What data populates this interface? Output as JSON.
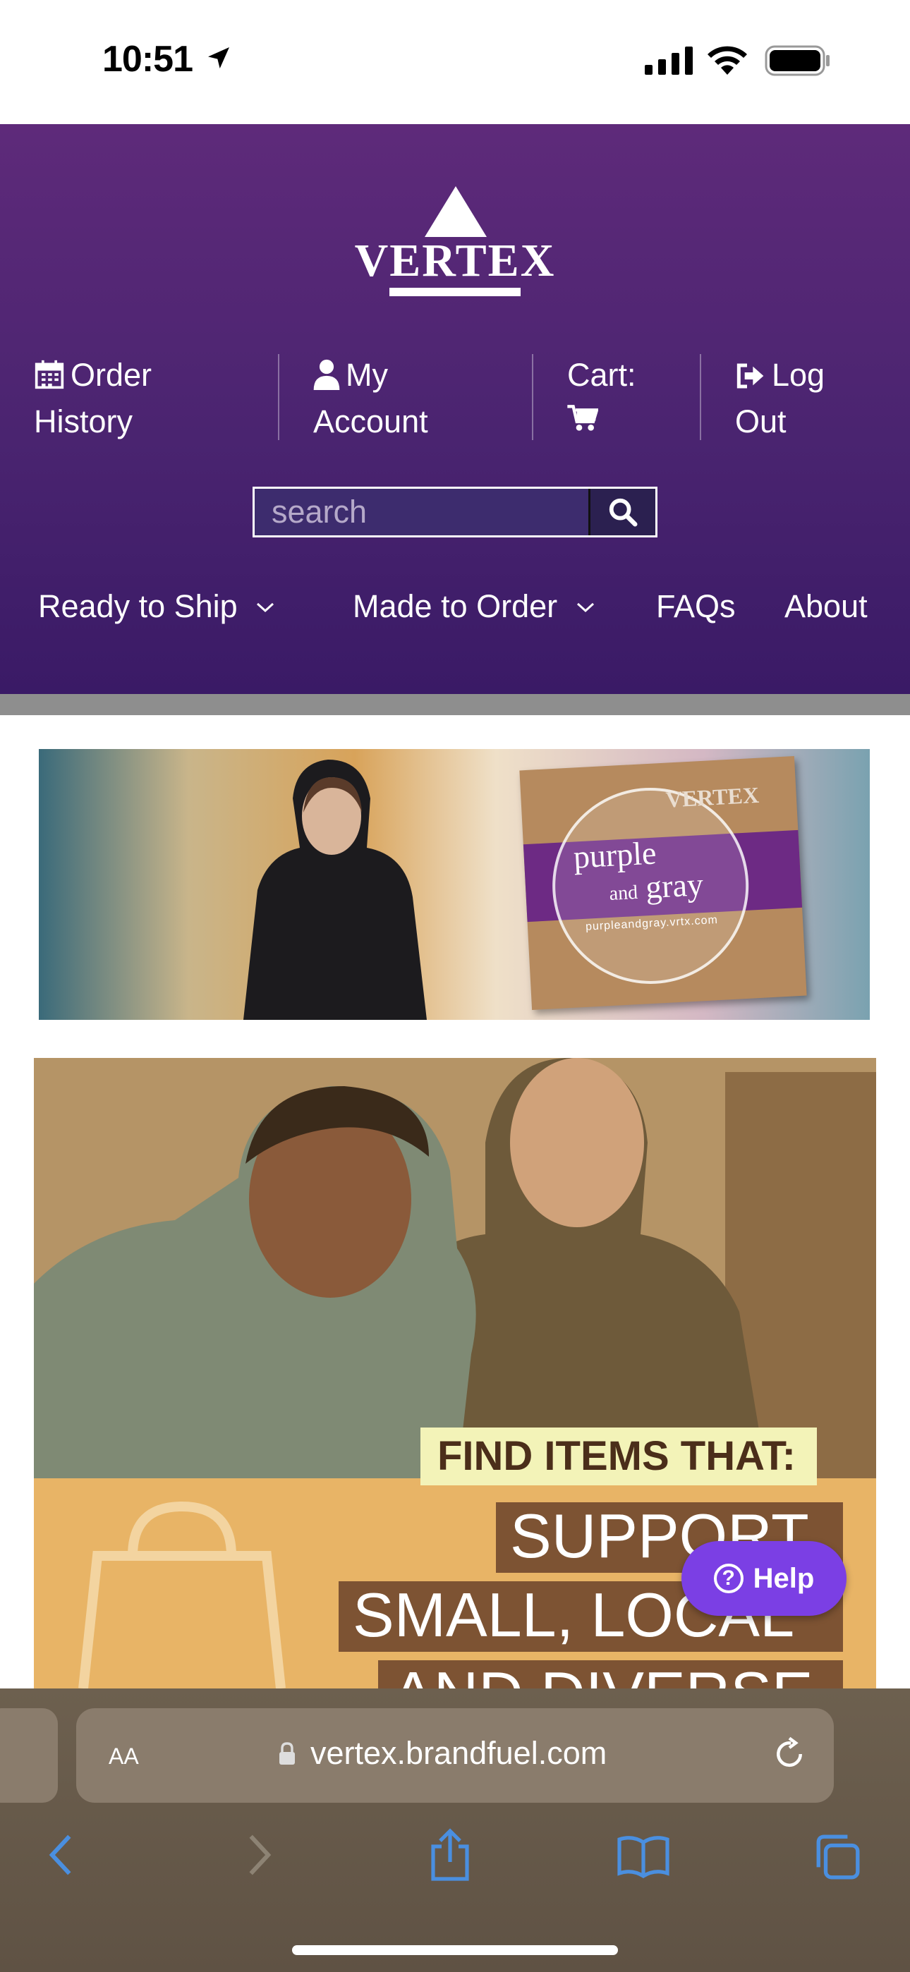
{
  "status_bar": {
    "time": "10:51"
  },
  "header": {
    "logo_text": "VERTEX",
    "account_links": [
      {
        "line1": "Order",
        "line2": "History",
        "icon": "calendar-icon"
      },
      {
        "line1": "My",
        "line2": "Account",
        "icon": "user-icon"
      },
      {
        "line1": "Cart:",
        "line2": "",
        "icon": "cart-icon"
      },
      {
        "line1": "Log",
        "line2": "Out",
        "icon": "sign-out-icon"
      }
    ],
    "search": {
      "placeholder": "search"
    },
    "nav": [
      {
        "label": "Ready to Ship",
        "has_dropdown": true
      },
      {
        "label": "Made to Order",
        "has_dropdown": true
      },
      {
        "label": "FAQs",
        "has_dropdown": false
      },
      {
        "label": "About",
        "has_dropdown": false
      }
    ]
  },
  "banners": {
    "purple_gray": {
      "title_line1": "purple",
      "title_small": "and",
      "title_line2": "gray",
      "url": "purpleandgray.vrtx.com",
      "brand": "VERTEX"
    },
    "find_items": {
      "headline": "FIND ITEMS THAT:",
      "lines": [
        "SUPPORT",
        "SMALL, LOCAL",
        "AND DIVERSE"
      ]
    }
  },
  "help_button": {
    "label": "Help"
  },
  "safari": {
    "text_size_label": "AA",
    "url": "vertex.brandfuel.com"
  },
  "colors": {
    "header_purple": "#4a2470",
    "help_purple": "#7b3fe4",
    "safari_bar": "#665848"
  }
}
